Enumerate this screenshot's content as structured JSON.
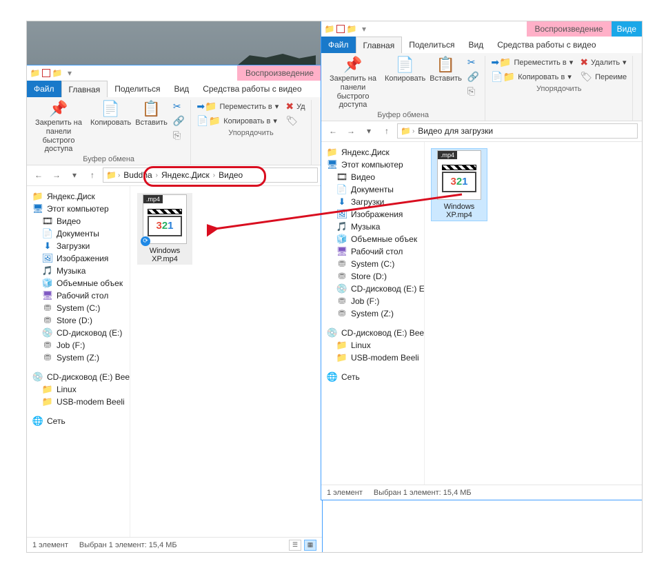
{
  "ctx_tab": "Воспроизведение",
  "ctx_more": "Виде",
  "tabs": {
    "file": "Файл",
    "home": "Главная",
    "share": "Поделиться",
    "view": "Вид",
    "tools": "Средства работы с видео"
  },
  "ribbon": {
    "pin": "Закрепить на панели быстрого доступа",
    "copy": "Копировать",
    "paste": "Вставить",
    "clipboard_grp": "Буфер обмена",
    "cut": "",
    "copy_path": "",
    "paste_shortcut": "",
    "move_to": "Переместить в",
    "copy_to": "Копировать в",
    "delete": "Удалить",
    "rename": "Переиме",
    "organize_grp": "Упорядочить"
  },
  "win1": {
    "crumbs": [
      "Buddha",
      "Яндекс.Диск",
      "Видео"
    ],
    "tree": [
      {
        "l": "la",
        "icon": "📁",
        "c": "c-fldr",
        "t": "Яндекс.Диск"
      },
      {
        "l": "la",
        "icon": "🖥",
        "c": "c-blue",
        "t": "Этот компьютер"
      },
      {
        "l": "lb",
        "icon": "🎞",
        "c": "",
        "t": "Видео"
      },
      {
        "l": "lb",
        "icon": "📄",
        "c": "c-grn",
        "t": "Документы"
      },
      {
        "l": "lb",
        "icon": "⬇",
        "c": "c-blue",
        "t": "Загрузки"
      },
      {
        "l": "lb",
        "icon": "🖼",
        "c": "c-blue",
        "t": "Изображения"
      },
      {
        "l": "lb",
        "icon": "🎵",
        "c": "c-blue",
        "t": "Музыка"
      },
      {
        "l": "lb",
        "icon": "🧊",
        "c": "c-blue",
        "t": "Объемные объек"
      },
      {
        "l": "lb",
        "icon": "🖥",
        "c": "c-pur",
        "t": "Рабочий стол"
      },
      {
        "l": "lb",
        "icon": "⛃",
        "c": "c-gray",
        "t": "System (C:)"
      },
      {
        "l": "lb",
        "icon": "⛃",
        "c": "c-gray",
        "t": "Store (D:)"
      },
      {
        "l": "lb",
        "icon": "💿",
        "c": "c-gray",
        "t": "CD-дисковод (E:)"
      },
      {
        "l": "lb",
        "icon": "⛃",
        "c": "c-gray",
        "t": "Job (F:)"
      },
      {
        "l": "lb",
        "icon": "⛃",
        "c": "c-gray",
        "t": "System (Z:)"
      },
      {
        "l": "la",
        "icon": "💿",
        "c": "c-gray",
        "t": "CD-дисковод (E:) Bee"
      },
      {
        "l": "lb",
        "icon": "📁",
        "c": "c-fldr",
        "t": "Linux"
      },
      {
        "l": "lb",
        "icon": "📁",
        "c": "c-fldr",
        "t": "USB-modem Beeli"
      },
      {
        "l": "la",
        "icon": "🌐",
        "c": "c-blue",
        "t": "Сеть"
      }
    ],
    "file": {
      "name": "Windows XP.mp4",
      "ext": ".mp4"
    },
    "status_count": "1 элемент",
    "status_sel": "Выбран 1 элемент: 15,4 МБ"
  },
  "win2": {
    "address": "Видео для загрузки",
    "tree": [
      {
        "l": "la",
        "icon": "📁",
        "c": "c-fldr",
        "t": "Яндекс.Диск"
      },
      {
        "l": "la",
        "icon": "🖥",
        "c": "c-blue",
        "t": "Этот компьютер"
      },
      {
        "l": "lb",
        "icon": "🎞",
        "c": "",
        "t": "Видео"
      },
      {
        "l": "lb",
        "icon": "📄",
        "c": "c-grn",
        "t": "Документы"
      },
      {
        "l": "lb",
        "icon": "⬇",
        "c": "c-blue",
        "t": "Загрузки"
      },
      {
        "l": "lb",
        "icon": "🖼",
        "c": "c-blue",
        "t": "Изображения"
      },
      {
        "l": "lb",
        "icon": "🎵",
        "c": "c-blue",
        "t": "Музыка"
      },
      {
        "l": "lb",
        "icon": "🧊",
        "c": "c-blue",
        "t": "Объемные объек"
      },
      {
        "l": "lb",
        "icon": "🖥",
        "c": "c-pur",
        "t": "Рабочий стол"
      },
      {
        "l": "lb",
        "icon": "⛃",
        "c": "c-gray",
        "t": "System (C:)"
      },
      {
        "l": "lb",
        "icon": "⛃",
        "c": "c-gray",
        "t": "Store (D:)"
      },
      {
        "l": "lb",
        "icon": "💿",
        "c": "c-gray",
        "t": "CD-дисковод (E:) E"
      },
      {
        "l": "lb",
        "icon": "⛃",
        "c": "c-gray",
        "t": "Job (F:)"
      },
      {
        "l": "lb",
        "icon": "⛃",
        "c": "c-gray",
        "t": "System (Z:)"
      },
      {
        "l": "la",
        "icon": "💿",
        "c": "c-gray",
        "t": "CD-дисковод (E:) Bee"
      },
      {
        "l": "lb",
        "icon": "📁",
        "c": "c-fldr",
        "t": "Linux"
      },
      {
        "l": "lb",
        "icon": "📁",
        "c": "c-fldr",
        "t": "USB-modem Beeli"
      },
      {
        "l": "la",
        "icon": "🌐",
        "c": "c-blue",
        "t": "Сеть"
      }
    ],
    "file": {
      "name": "Windows XP.mp4",
      "ext": ".mp4"
    },
    "status_count": "1 элемент",
    "status_sel": "Выбран 1 элемент: 15,4 МБ"
  },
  "delete_short": "Уд"
}
